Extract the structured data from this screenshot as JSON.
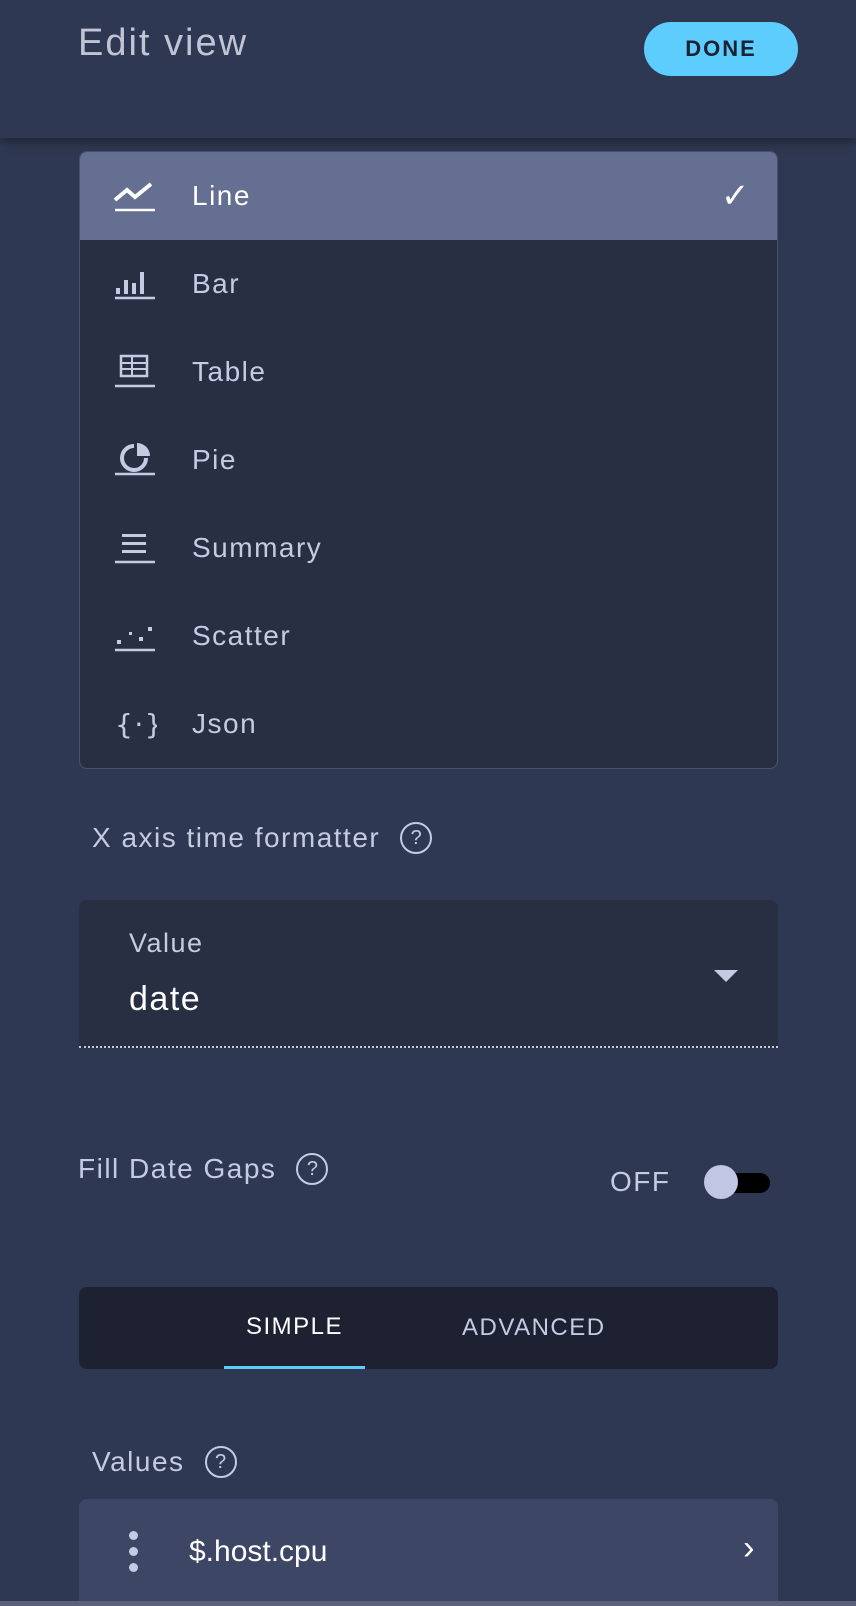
{
  "header": {
    "title": "Edit view",
    "done_label": "DONE"
  },
  "view_types": {
    "selected": "Line",
    "items": [
      {
        "label": "Line",
        "icon": "line-chart-icon"
      },
      {
        "label": "Bar",
        "icon": "bar-chart-icon"
      },
      {
        "label": "Table",
        "icon": "table-icon"
      },
      {
        "label": "Pie",
        "icon": "pie-chart-icon"
      },
      {
        "label": "Summary",
        "icon": "summary-icon"
      },
      {
        "label": "Scatter",
        "icon": "scatter-icon"
      },
      {
        "label": "Json",
        "icon": "json-icon"
      }
    ]
  },
  "x_axis": {
    "label": "X axis time formatter",
    "field_label": "Value",
    "value": "date"
  },
  "fill_date_gaps": {
    "label": "Fill Date Gaps",
    "state": "OFF",
    "enabled": false
  },
  "tabs": [
    {
      "label": "SIMPLE",
      "active": true
    },
    {
      "label": "ADVANCED",
      "active": false
    }
  ],
  "values": {
    "label": "Values",
    "items": [
      {
        "value": "$.host.cpu"
      }
    ]
  },
  "colors": {
    "accent": "#5ccdfc",
    "selected": "#646f92",
    "background": "#2f3852"
  }
}
